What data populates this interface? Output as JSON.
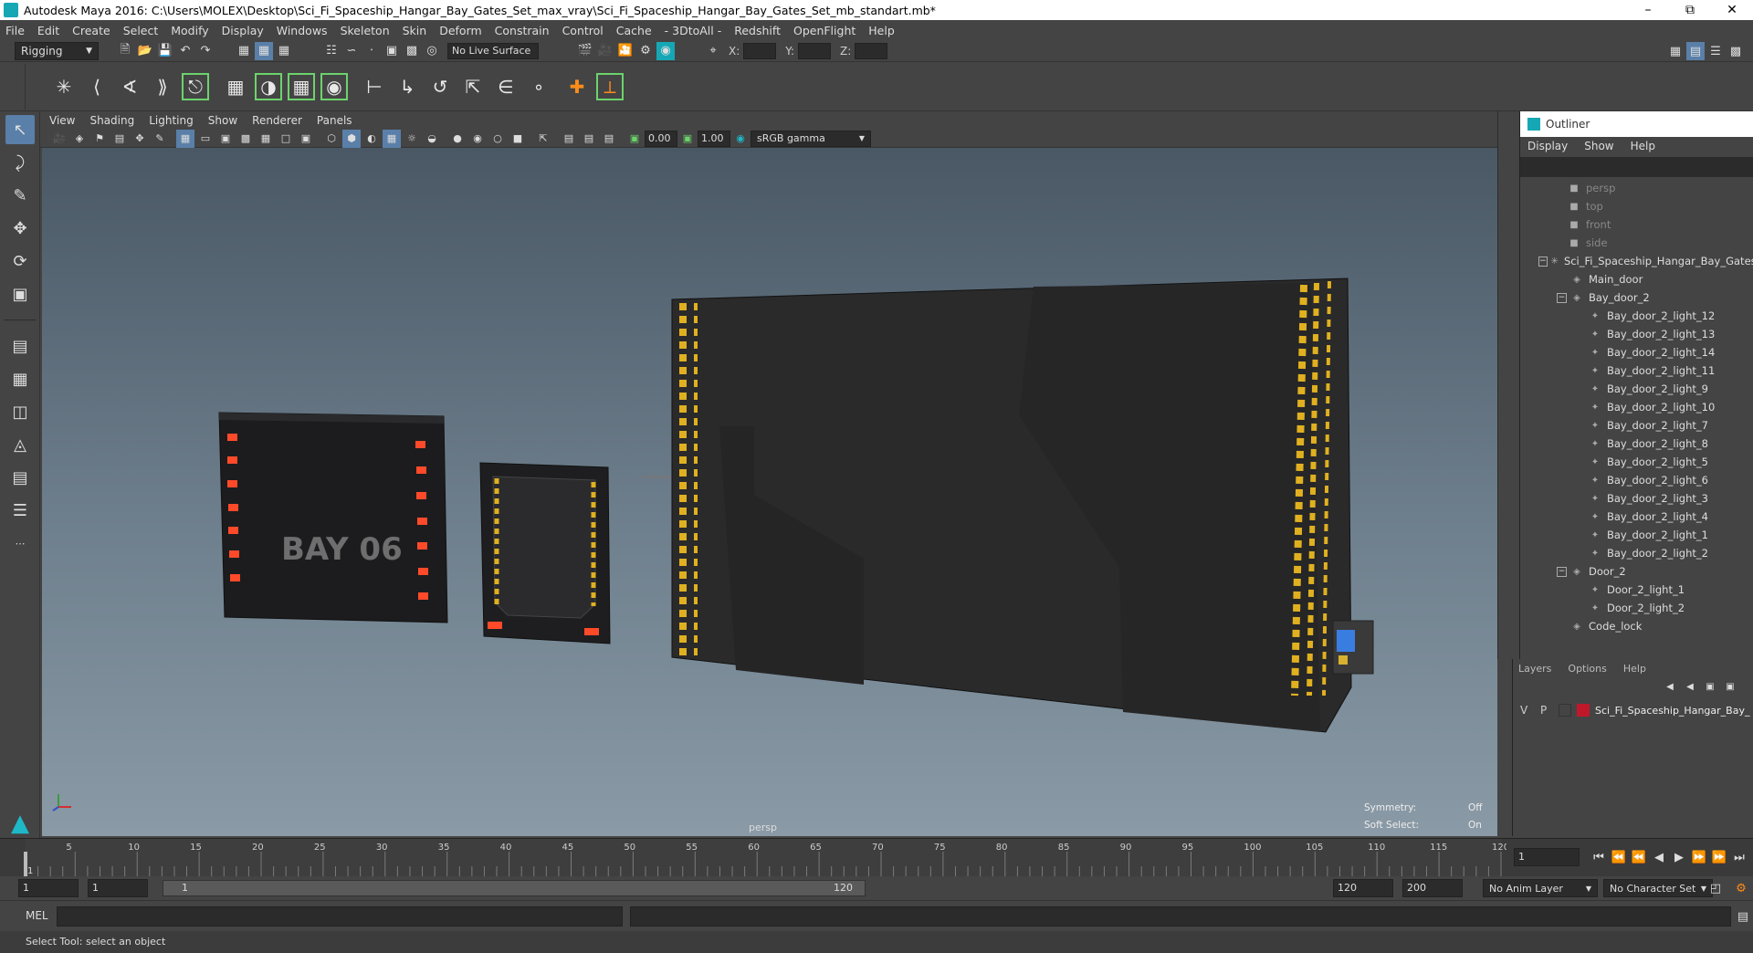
{
  "window": {
    "title": "Autodesk Maya 2016: C:\\Users\\MOLEX\\Desktop\\Sci_Fi_Spaceship_Hangar_Bay_Gates_Set_max_vray\\Sci_Fi_Spaceship_Hangar_Bay_Gates_Set_mb_standart.mb*"
  },
  "menubar": [
    "File",
    "Edit",
    "Create",
    "Select",
    "Modify",
    "Display",
    "Windows",
    "Skeleton",
    "Skin",
    "Deform",
    "Constrain",
    "Control",
    "Cache",
    "- 3DtoAll -",
    "Redshift",
    "OpenFlight",
    "Help"
  ],
  "statusline": {
    "mode": "Rigging",
    "live_surface": "No Live Surface",
    "x_label": "X:",
    "y_label": "Y:",
    "z_label": "Z:"
  },
  "panel": {
    "menus": [
      "View",
      "Shading",
      "Lighting",
      "Show",
      "Renderer",
      "Panels"
    ],
    "exposure": "0.00",
    "gamma": "1.00",
    "color_space": "sRGB gamma"
  },
  "viewport": {
    "camera_label": "persp",
    "symmetry_label": "Symmetry:",
    "symmetry_value": "Off",
    "soft_select_label": "Soft Select:",
    "soft_select_value": "On",
    "decal_text": "BAY 06"
  },
  "outliner": {
    "title": "Outliner",
    "menus": [
      "Display",
      "Show",
      "Help"
    ],
    "cameras": [
      "persp",
      "top",
      "front",
      "side"
    ],
    "items": [
      {
        "label": "Sci_Fi_Spaceship_Hangar_Bay_Gates",
        "depth": 0,
        "toggle": "−",
        "type": "group"
      },
      {
        "label": "Main_door",
        "depth": 1,
        "toggle": "",
        "type": "mesh"
      },
      {
        "label": "Bay_door_2",
        "depth": 1,
        "toggle": "−",
        "type": "mesh"
      },
      {
        "label": "Bay_door_2_light_12",
        "depth": 2,
        "toggle": "",
        "type": "light"
      },
      {
        "label": "Bay_door_2_light_13",
        "depth": 2,
        "toggle": "",
        "type": "light"
      },
      {
        "label": "Bay_door_2_light_14",
        "depth": 2,
        "toggle": "",
        "type": "light"
      },
      {
        "label": "Bay_door_2_light_11",
        "depth": 2,
        "toggle": "",
        "type": "light"
      },
      {
        "label": "Bay_door_2_light_9",
        "depth": 2,
        "toggle": "",
        "type": "light"
      },
      {
        "label": "Bay_door_2_light_10",
        "depth": 2,
        "toggle": "",
        "type": "light"
      },
      {
        "label": "Bay_door_2_light_7",
        "depth": 2,
        "toggle": "",
        "type": "light"
      },
      {
        "label": "Bay_door_2_light_8",
        "depth": 2,
        "toggle": "",
        "type": "light"
      },
      {
        "label": "Bay_door_2_light_5",
        "depth": 2,
        "toggle": "",
        "type": "light"
      },
      {
        "label": "Bay_door_2_light_6",
        "depth": 2,
        "toggle": "",
        "type": "light"
      },
      {
        "label": "Bay_door_2_light_3",
        "depth": 2,
        "toggle": "",
        "type": "light"
      },
      {
        "label": "Bay_door_2_light_4",
        "depth": 2,
        "toggle": "",
        "type": "light"
      },
      {
        "label": "Bay_door_2_light_1",
        "depth": 2,
        "toggle": "",
        "type": "light"
      },
      {
        "label": "Bay_door_2_light_2",
        "depth": 2,
        "toggle": "",
        "type": "light"
      },
      {
        "label": "Door_2",
        "depth": 1,
        "toggle": "−",
        "type": "mesh"
      },
      {
        "label": "Door_2_light_1",
        "depth": 2,
        "toggle": "",
        "type": "light"
      },
      {
        "label": "Door_2_light_2",
        "depth": 2,
        "toggle": "",
        "type": "light"
      },
      {
        "label": "Code_lock",
        "depth": 1,
        "toggle": "",
        "type": "mesh"
      }
    ]
  },
  "layers": {
    "menus": [
      "Layers",
      "Options",
      "Help"
    ],
    "row": {
      "v": "V",
      "p": "P",
      "name": "Sci_Fi_Spaceship_Hangar_Bay_",
      "color": "#c0182a"
    }
  },
  "timeline": {
    "ticks": [
      "5",
      "10",
      "15",
      "20",
      "25",
      "30",
      "35",
      "40",
      "45",
      "50",
      "55",
      "60",
      "65",
      "70",
      "75",
      "80",
      "85",
      "90",
      "95",
      "100",
      "105",
      "110",
      "115",
      "120"
    ],
    "start_tick": "1",
    "current_frame": "1"
  },
  "range": {
    "start": "1",
    "playback_start": "1",
    "slider_start": "1",
    "slider_end": "120",
    "playback_end": "120",
    "end": "200",
    "anim_layer": "No Anim Layer",
    "character_set": "No Character Set"
  },
  "command": {
    "lang": "MEL"
  },
  "help": {
    "text": "Select Tool: select an object"
  }
}
